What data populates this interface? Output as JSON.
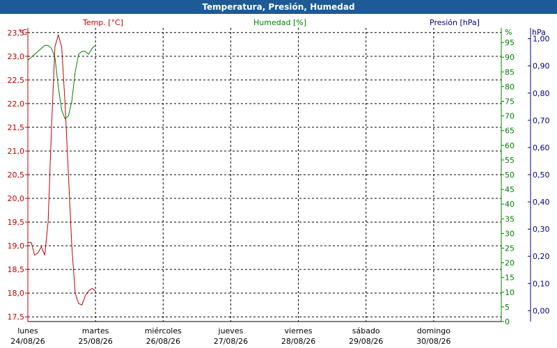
{
  "window": {
    "title": "Temperatura, Presión, Humedad"
  },
  "colors": {
    "temperature": "#c00000",
    "humidity": "#008000",
    "pressure": "#000080",
    "grid": "#000000",
    "titlebar": "#1e5a96"
  },
  "chart_data": {
    "type": "line",
    "title": "Temperatura, Presión, Humedad",
    "grid": true,
    "x": {
      "ticks": [
        {
          "day": "lunes",
          "date": "24/08/26"
        },
        {
          "day": "martes",
          "date": "25/08/26"
        },
        {
          "day": "miércoles",
          "date": "26/08/26"
        },
        {
          "day": "jueves",
          "date": "27/08/26"
        },
        {
          "day": "viernes",
          "date": "28/08/26"
        },
        {
          "day": "sábado",
          "date": "29/08/26"
        },
        {
          "day": "domingo",
          "date": "30/08/26"
        }
      ],
      "range_days": [
        0,
        7
      ]
    },
    "axes": {
      "temperature": {
        "label": "Temp. [°C]",
        "unit": "°C",
        "range": [
          17.4,
          23.6
        ],
        "ticks": [
          "17,5",
          "18,0",
          "18,5",
          "19,0",
          "19,5",
          "20,0",
          "20,5",
          "21,0",
          "21,5",
          "22,0",
          "22,5",
          "23,0",
          "23,5"
        ],
        "tick_values": [
          17.5,
          18.0,
          18.5,
          19.0,
          19.5,
          20.0,
          20.5,
          21.0,
          21.5,
          22.0,
          22.5,
          23.0,
          23.5
        ]
      },
      "humidity": {
        "label": "Humedad [%]",
        "unit": "%",
        "range": [
          0,
          100
        ],
        "ticks": [
          "0",
          "5",
          "10",
          "15",
          "20",
          "25",
          "30",
          "35",
          "40",
          "45",
          "50",
          "55",
          "60",
          "65",
          "70",
          "75",
          "80",
          "85",
          "90",
          "95"
        ],
        "tick_values": [
          0,
          5,
          10,
          15,
          20,
          25,
          30,
          35,
          40,
          45,
          50,
          55,
          60,
          65,
          70,
          75,
          80,
          85,
          90,
          95
        ]
      },
      "pressure": {
        "label": "Presión [hPa]",
        "unit": "hPa",
        "range": [
          -0.04,
          1.04
        ],
        "ticks": [
          "0,00",
          "0,10",
          "0,20",
          "0,30",
          "0,40",
          "0,50",
          "0,60",
          "0,70",
          "0,80",
          "0,90",
          "1,00"
        ],
        "tick_values": [
          0.0,
          0.1,
          0.2,
          0.3,
          0.4,
          0.5,
          0.6,
          0.7,
          0.8,
          0.9,
          1.0
        ]
      }
    },
    "series": [
      {
        "name": "Temp. [°C]",
        "axis": "temperature",
        "x_days": [
          0.0,
          0.05,
          0.1,
          0.15,
          0.2,
          0.25,
          0.3,
          0.35,
          0.4,
          0.45,
          0.5,
          0.55,
          0.6,
          0.65,
          0.7,
          0.75,
          0.8,
          0.85,
          0.9,
          0.95,
          1.0
        ],
        "values": [
          19.07,
          19.07,
          18.8,
          18.85,
          18.98,
          18.8,
          19.5,
          21.5,
          23.2,
          23.45,
          23.2,
          22.0,
          20.5,
          19.0,
          18.0,
          17.78,
          17.75,
          17.95,
          18.05,
          18.1,
          18.05
        ]
      },
      {
        "name": "Humedad [%]",
        "axis": "humidity",
        "x_days": [
          0.0,
          0.05,
          0.1,
          0.15,
          0.2,
          0.25,
          0.3,
          0.35,
          0.4,
          0.45,
          0.5,
          0.55,
          0.6,
          0.65,
          0.7,
          0.75,
          0.8,
          0.85,
          0.9,
          0.95,
          1.0
        ],
        "values": [
          89,
          90,
          91,
          92,
          93,
          94,
          94,
          93,
          90,
          80,
          72,
          69,
          70,
          75,
          85,
          91,
          92,
          92,
          91,
          93,
          94
        ]
      }
    ]
  }
}
